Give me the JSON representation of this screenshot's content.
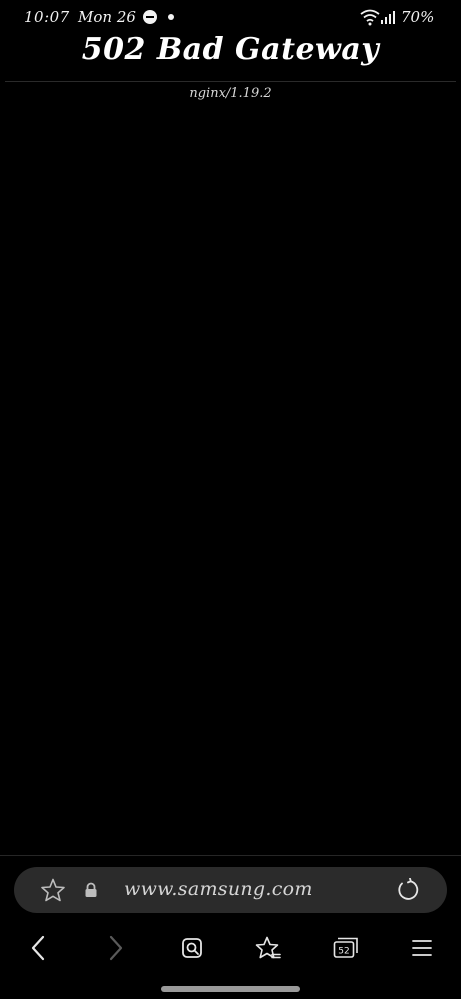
{
  "status_bar": {
    "time": "10:07",
    "date": "Mon 26",
    "battery": "70%",
    "icons": [
      "do-not-disturb-icon",
      "notification-dot-icon",
      "wifi-icon",
      "signal-icon"
    ]
  },
  "page": {
    "title": "502 Bad Gateway",
    "server": "nginx/1.19.2",
    "background_color": "#000000",
    "text_color": "#ffffff"
  },
  "browser": {
    "url": "www.samsung.com",
    "icons": [
      "star-icon",
      "lock-icon",
      "reload-icon"
    ],
    "nav": [
      {
        "name": "back",
        "icon": "back-arrow-icon",
        "enabled": true
      },
      {
        "name": "forward",
        "icon": "forward-arrow-icon",
        "enabled": false
      },
      {
        "name": "search",
        "icon": "search-icon",
        "enabled": true
      },
      {
        "name": "bookmarks",
        "icon": "bookmarks-icon",
        "enabled": true
      },
      {
        "name": "tabs",
        "icon": "tabs-icon",
        "tab_count": "52",
        "enabled": true
      },
      {
        "name": "menu",
        "icon": "menu-icon",
        "enabled": true
      }
    ],
    "url_bar_color": "#2b2b2b"
  }
}
